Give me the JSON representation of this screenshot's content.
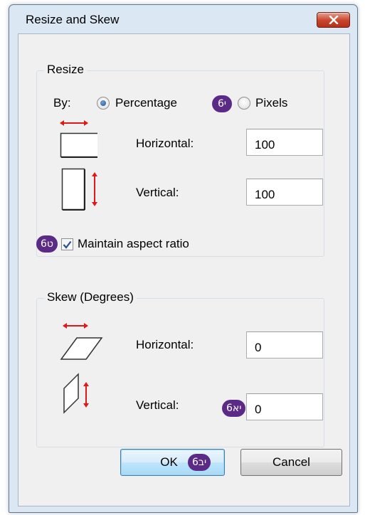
{
  "window": {
    "title": "Resize and Skew"
  },
  "resize": {
    "legend": "Resize",
    "by_label": "By:",
    "percentage_label": "Percentage",
    "pixels_label": "Pixels",
    "selected": "Percentage",
    "horizontal_label": "Horizontal:",
    "horizontal_value": "100",
    "vertical_label": "Vertical:",
    "vertical_value": "100",
    "maintain_label": "Maintain aspect ratio",
    "maintain_checked": true
  },
  "skew": {
    "legend": "Skew (Degrees)",
    "horizontal_label": "Horizontal:",
    "horizontal_value": "0",
    "vertical_label": "Vertical:",
    "vertical_value": "0"
  },
  "buttons": {
    "ok_label": "OK",
    "cancel_label": "Cancel"
  },
  "badges": {
    "pixels_badge": "6י",
    "maintain_badge": "6ט",
    "skew_vertical_badge": "6יא",
    "ok_badge": "6יב"
  },
  "colors": {
    "badge": "#5b2a86",
    "arrow": "#e0181a",
    "close": "#c7432a"
  }
}
